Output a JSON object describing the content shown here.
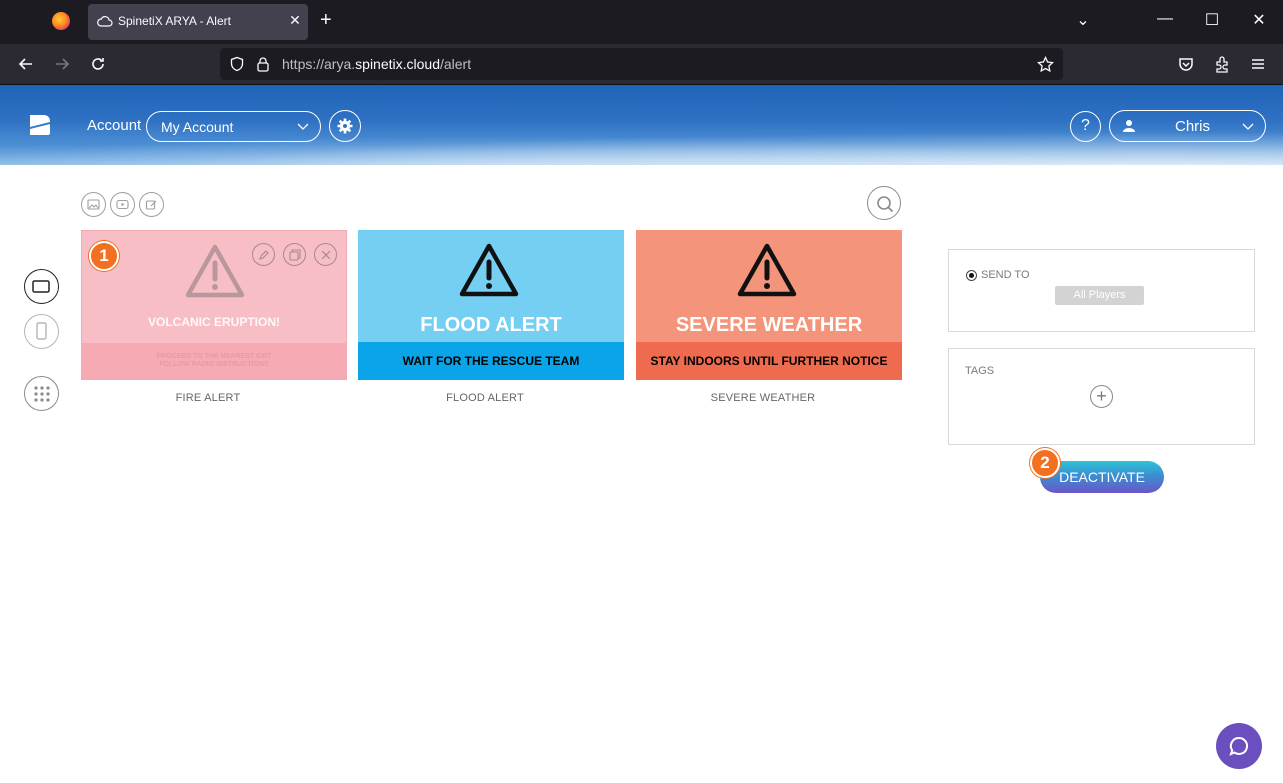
{
  "browser": {
    "tab_title": "SpinetiX ARYA - Alert",
    "tab_close": "✕",
    "new_tab": "+",
    "url_prefix": "https://arya.",
    "url_host": "spinetix.cloud",
    "url_path": "/alert",
    "window_controls": [
      "⌄",
      "—",
      "☐",
      "✕"
    ]
  },
  "header": {
    "account_label": "Account",
    "account_value": "My Account",
    "help_label": "?",
    "user_name": "Chris"
  },
  "cards": [
    {
      "label": "FIRE ALERT",
      "title": "VOLCANIC ERUPTION!",
      "message_line1": "PROCEED TO THE NEAREST EXIT",
      "message_line2": "FOLLOW RADIO INSTRUCTIONS",
      "background": "#f8bec6",
      "selected": true
    },
    {
      "label": "FLOOD ALERT",
      "title": "FLOOD ALERT",
      "message": "WAIT FOR THE RESCUE TEAM",
      "background": "#74cff2"
    },
    {
      "label": "SEVERE WEATHER",
      "title": "SEVERE WEATHER",
      "message": "STAY INDOORS UNTIL FURTHER NOTICE",
      "background": "#f4947a"
    }
  ],
  "panel": {
    "send_to_label": "SEND TO",
    "players_chip": "All Players",
    "tags_label": "TAGS",
    "add_tag": "+"
  },
  "actions": {
    "deactivate_label": "DEACTIVATE"
  },
  "badges": {
    "step1": "1",
    "step2": "2"
  },
  "colors": {
    "accent_orange": "#f37021",
    "chat_purple": "#6b4fbf"
  }
}
